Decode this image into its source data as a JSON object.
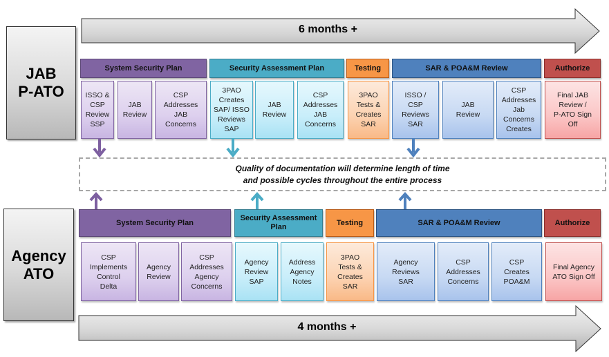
{
  "jab": {
    "label": "JAB\nP-ATO",
    "duration": "6 months +",
    "phases": [
      {
        "label": "System Security Plan",
        "color": "#8064a2"
      },
      {
        "label": "Security Assessment Plan",
        "color": "#4bacc6"
      },
      {
        "label": "Testing",
        "color": "#f79646"
      },
      {
        "label": "SAR & POA&M Review",
        "color": "#4f81bd"
      },
      {
        "label": "Authorize",
        "color": "#c0504d"
      }
    ],
    "steps": [
      "ISSO &\nCSP\nReview\nSSP",
      "JAB\nReview",
      "CSP\nAddresses\nJAB\nConcerns",
      "3PAO\nCreates\nSAP/ ISSO\nReviews\nSAP",
      "JAB\nReview",
      "CSP\nAddresses\nJAB\nConcerns",
      "3PAO\nTests &\nCreates\nSAR",
      "ISSO /\nCSP\nReviews\nSAR",
      "JAB\nReview",
      "CSP\nAddresses\nJab\nConcerns\nCreates",
      "Final JAB\nReview /\nP-ATO Sign\nOff"
    ]
  },
  "quality_note": "Quality of documentation will determine length of time\nand possible cycles throughout the entire process",
  "agency": {
    "label": "Agency\nATO",
    "duration": "4 months +",
    "phases": [
      {
        "label": "System Security Plan",
        "color": "#8064a2"
      },
      {
        "label": "Security Assessment Plan",
        "color": "#4bacc6"
      },
      {
        "label": "Testing",
        "color": "#f79646"
      },
      {
        "label": "SAR & POA&M Review",
        "color": "#4f81bd"
      },
      {
        "label": "Authorize",
        "color": "#c0504d"
      }
    ],
    "steps": [
      "CSP\nImplements\nControl\nDelta",
      "Agency\nReview",
      "CSP\nAddresses\nAgency\nConcerns",
      "Agency\nReview\nSAP",
      "Address\nAgency\nNotes",
      "3PAO\nTests &\nCreates\nSAR",
      "Agency\nReviews\nSAR",
      "CSP\nAddresses\nConcerns",
      "CSP\nCreates\nPOA&M",
      "Final Agency\nATO Sign Off"
    ]
  },
  "connector_colors": {
    "purple": "#7d5fa0",
    "teal": "#4bacc6",
    "blue": "#4f81bd"
  }
}
